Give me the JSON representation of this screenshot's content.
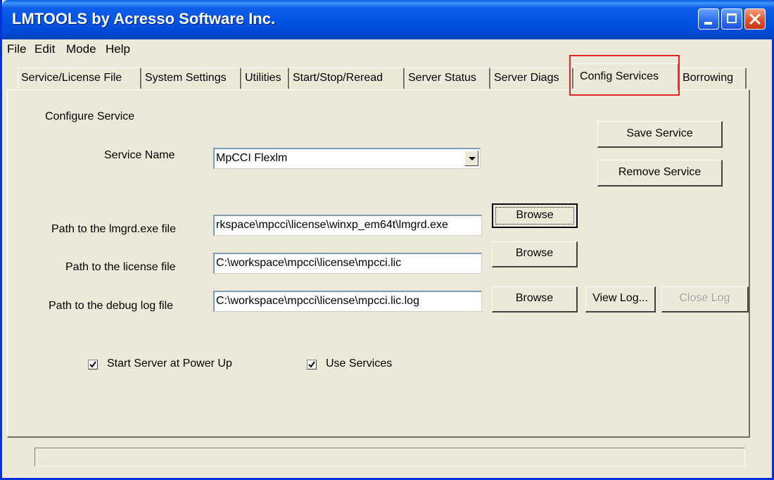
{
  "window": {
    "title": "LMTOOLS by Acresso Software Inc."
  },
  "menu": [
    "File",
    "Edit",
    "Mode",
    "Help"
  ],
  "tabs": [
    {
      "label": "Service/License File"
    },
    {
      "label": "System Settings"
    },
    {
      "label": "Utilities"
    },
    {
      "label": "Start/Stop/Reread"
    },
    {
      "label": "Server Status"
    },
    {
      "label": "Server Diags"
    },
    {
      "label": "Config Services",
      "active": true
    },
    {
      "label": "Borrowing"
    }
  ],
  "config": {
    "section_title": "Configure Service",
    "service_name_label": "Service Name",
    "service_name_value": "MpCCI Flexlm",
    "lmgrd_label": "Path to the lmgrd.exe file",
    "lmgrd_value": "rkspace\\mpcci\\license\\winxp_em64t\\lmgrd.exe",
    "license_label": "Path to the license file",
    "license_value": "C:\\workspace\\mpcci\\license\\mpcci.lic",
    "debug_label": "Path to the debug log file",
    "debug_value": "C:\\workspace\\mpcci\\license\\mpcci.lic.log",
    "browse_label": "Browse",
    "view_log_label": "View Log...",
    "close_log_label": "Close Log",
    "save_service_label": "Save Service",
    "remove_service_label": "Remove Service",
    "start_at_power_up_label": "Start Server at Power Up",
    "start_at_power_up_checked": true,
    "use_services_label": "Use Services",
    "use_services_checked": true
  },
  "colors": {
    "titlebar": "#0054e3",
    "face": "#ece9d8",
    "highlight_box": "#e8262a"
  },
  "icons": {
    "minimize": "minimize-icon",
    "maximize": "maximize-icon",
    "close": "close-icon",
    "dropdown": "chevron-down-icon",
    "check": "checkmark-icon"
  }
}
